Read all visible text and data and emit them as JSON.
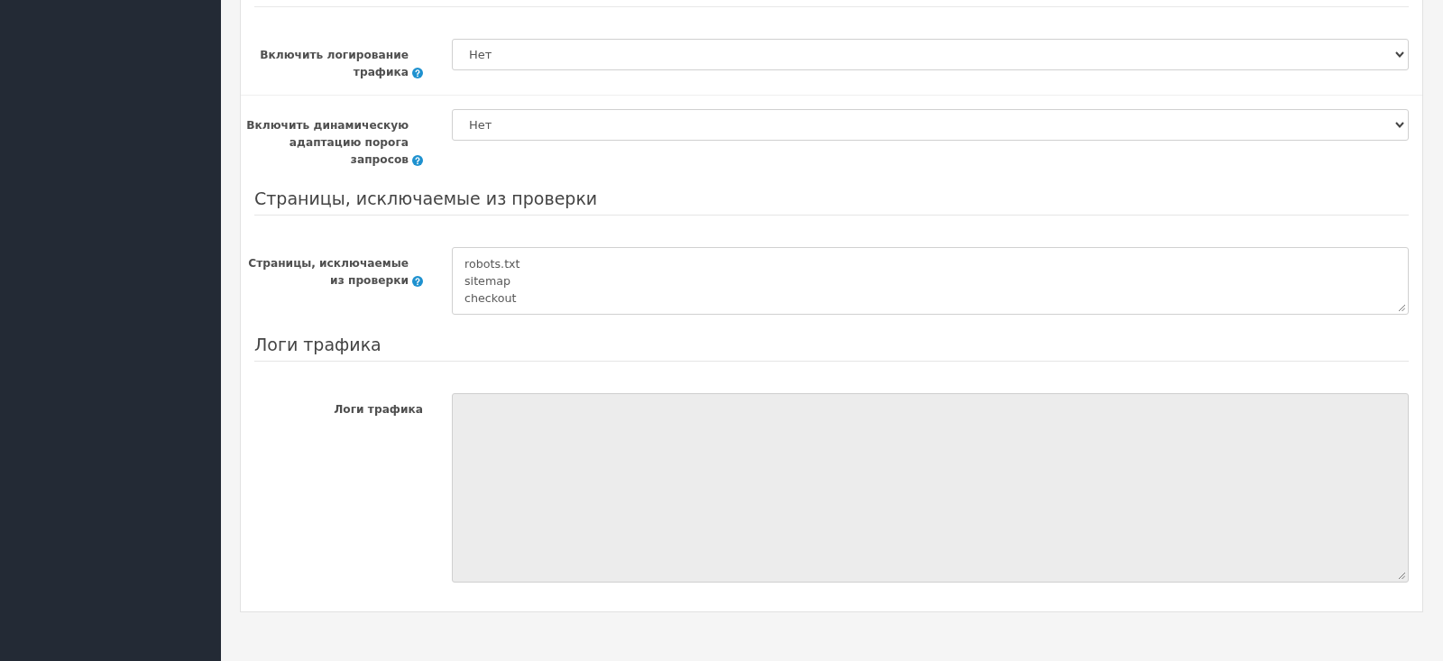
{
  "sections": [
    {
      "fields": [
        {
          "kind": "select",
          "label": "Включить логирование трафика",
          "help": true,
          "value": "Нет"
        },
        {
          "kind": "select",
          "label": "Включить динамическую адаптацию порога запросов",
          "help": true,
          "value": "Нет"
        }
      ]
    },
    {
      "title": "Страницы, исключаемые из проверки",
      "fields": [
        {
          "kind": "textarea",
          "label": "Страницы, исключаемые из проверки",
          "help": true,
          "disabled": false,
          "lines": [
            "robots.txt",
            "sitemap",
            "checkout"
          ]
        }
      ]
    },
    {
      "title": "Логи трафика",
      "fields": [
        {
          "kind": "textarea",
          "label": "Логи трафика",
          "help": false,
          "disabled": true
        }
      ]
    }
  ]
}
